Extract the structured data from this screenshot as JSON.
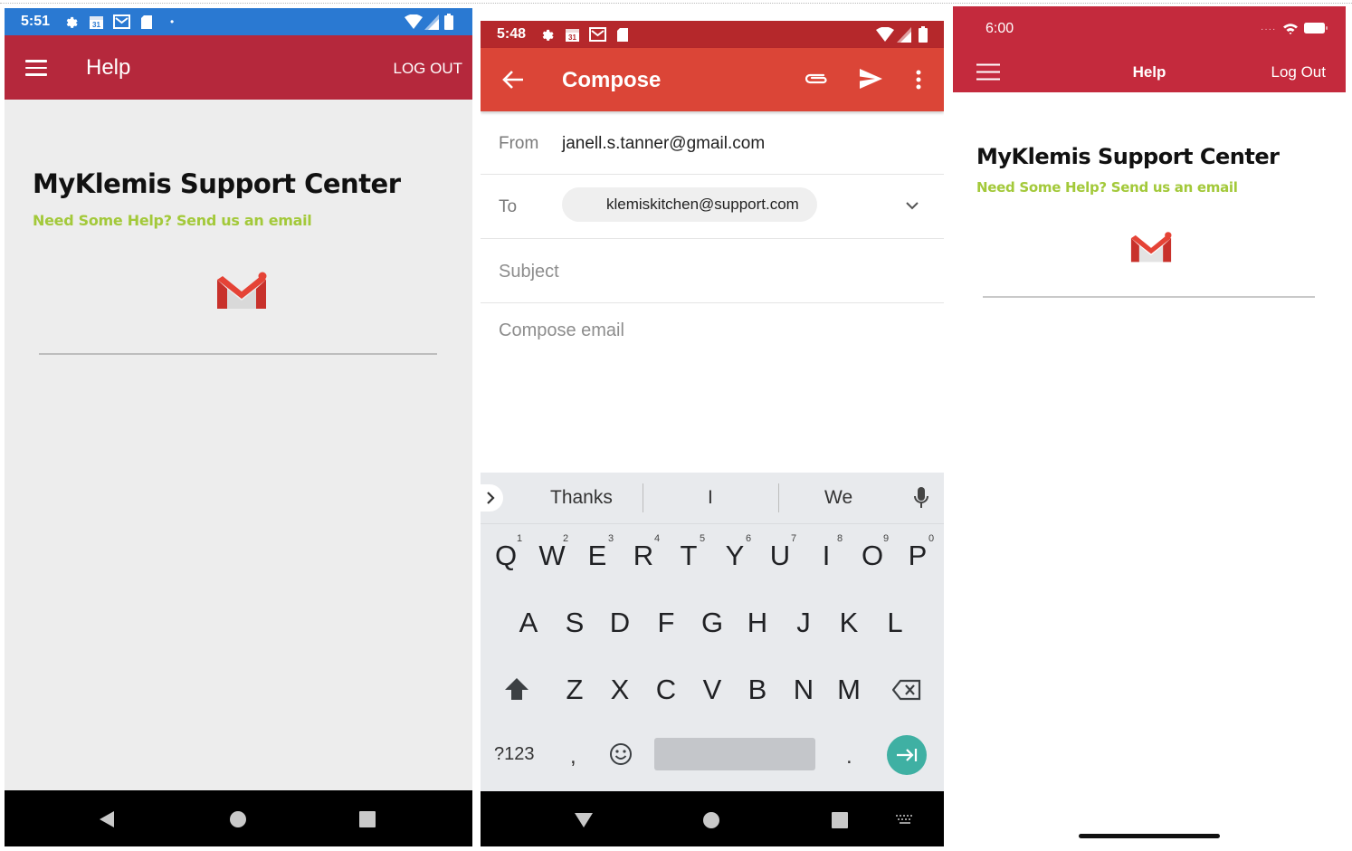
{
  "panel1": {
    "status_time": "5:51",
    "title": "Help",
    "logout_label": "LOG OUT",
    "heading": "MyKlemis Support Center",
    "subheading": "Need Some Help? Send us an email"
  },
  "panel2": {
    "status_time": "5:48",
    "title": "Compose",
    "from_label": "From",
    "from_value": "janell.s.tanner@gmail.com",
    "to_label": "To",
    "to_value": "klemiskitchen@support.com",
    "subject_placeholder": "Subject",
    "body_placeholder": "Compose email",
    "suggestions": [
      "Thanks",
      "I",
      "We"
    ],
    "keyboard": {
      "row1": [
        "Q",
        "W",
        "E",
        "R",
        "T",
        "Y",
        "U",
        "I",
        "O",
        "P"
      ],
      "row1_hints": [
        "1",
        "2",
        "3",
        "4",
        "5",
        "6",
        "7",
        "8",
        "9",
        "0"
      ],
      "row2": [
        "A",
        "S",
        "D",
        "F",
        "G",
        "H",
        "J",
        "K",
        "L"
      ],
      "row3": [
        "Z",
        "X",
        "C",
        "V",
        "B",
        "N",
        "M"
      ],
      "symbols_label": "?123",
      "comma": ",",
      "period": "."
    }
  },
  "panel3": {
    "status_time": "6:00",
    "title": "Help",
    "logout_label": "Log Out",
    "heading": "MyKlemis Support Center",
    "subheading": "Need Some Help? Send us an email"
  },
  "colors": {
    "android_help_bar": "#b5283c",
    "android_status_blue": "#2a79d2",
    "gmail_red": "#db4537",
    "gmail_status": "#b5282b",
    "ios_header": "#c42a3d",
    "subtitle_green": "#a3c93a",
    "keyboard_enter_teal": "#3fb0a3"
  }
}
